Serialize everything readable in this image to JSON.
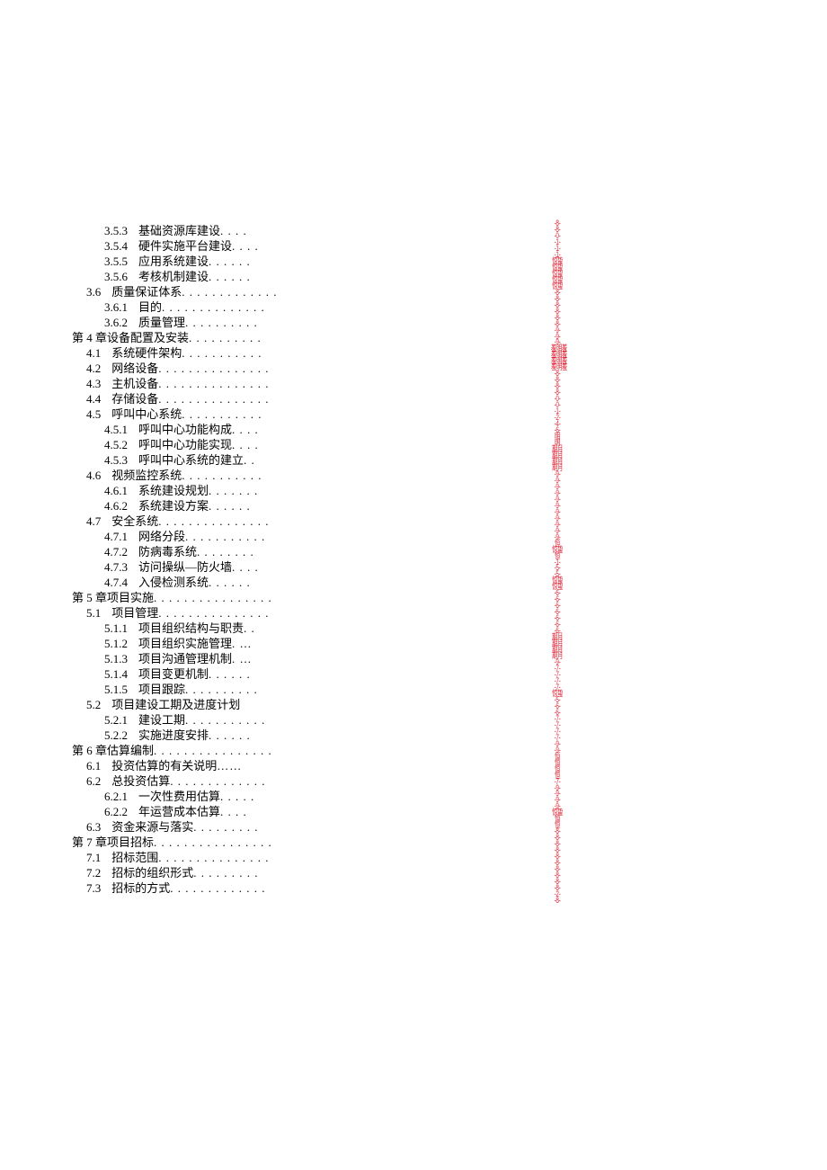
{
  "toc": [
    {
      "level": 2,
      "num": "3.5.3",
      "title": "基础资源库建设",
      "dots": " . . . ."
    },
    {
      "level": 2,
      "num": "3.5.4",
      "title": "硬件实施平台建设",
      "dots": ". . . ."
    },
    {
      "level": 2,
      "num": "3.5.5",
      "title": "应用系统建设",
      "dots": " . . . . . ."
    },
    {
      "level": 2,
      "num": "3.5.6",
      "title": "考核机制建设",
      "dots": " . . . . . ."
    },
    {
      "level": 1,
      "num": "3.6",
      "title": "质量保证体系",
      "dots": " . . . . . . . . . . . . ."
    },
    {
      "level": 2,
      "num": "3.6.1",
      "title": "目的",
      "dots": ". . . . . . . . . . . . . ."
    },
    {
      "level": 2,
      "num": "3.6.2",
      "title": "质量管理",
      "dots": " . . . . . . . . . ."
    },
    {
      "level": 0,
      "num": "第 4 章",
      "title": "设备配置及安装",
      "dots": " . . . . . . . . . .",
      "chapter": true
    },
    {
      "level": 1,
      "num": "4.1",
      "title": "系统硬件架构",
      "dots": " . . . . . . . . . . ."
    },
    {
      "level": 1,
      "num": "4.2",
      "title": "网络设备",
      "dots": " . . . . . . . . . . . . . . ."
    },
    {
      "level": 1,
      "num": "4.3",
      "title": "主机设备",
      "dots": " . . . . . . . . . . . . . . ."
    },
    {
      "level": 1,
      "num": "4.4",
      "title": "存储设备",
      "dots": " . . . . . . . . . . . . . . ."
    },
    {
      "level": 1,
      "num": "4.5",
      "title": "呼叫中心系统",
      "dots": ". . . . . . . . . . ."
    },
    {
      "level": 2,
      "num": "4.5.1",
      "title": "呼叫中心功能构成",
      "dots": ". . . ."
    },
    {
      "level": 2,
      "num": "4.5.2",
      "title": "呼叫中心功能实现",
      "dots": ". . . ."
    },
    {
      "level": 2,
      "num": "4.5.3",
      "title": "呼叫中心系统的建立",
      "dots": ". ."
    },
    {
      "level": 1,
      "num": "4.6",
      "title": "视频监控系统",
      "dots": " . . . . . . . . . . ."
    },
    {
      "level": 2,
      "num": "4.6.1",
      "title": "系统建设规划",
      "dots": ". . . . . . ."
    },
    {
      "level": 2,
      "num": "4.6.2",
      "title": "系统建设方案",
      "dots": " . . . . . ."
    },
    {
      "level": 1,
      "num": "4.7",
      "title": "安全系统",
      "dots": ". . . . . . . . . . . . . . ."
    },
    {
      "level": 2,
      "num": "4.7.1",
      "title": "网络分段",
      "dots": ". . . . . . . . . . ."
    },
    {
      "level": 2,
      "num": "4.7.2",
      "title": "防病毒系统",
      "dots": " . . . . . . . ."
    },
    {
      "level": 2,
      "num": "4.7.3",
      "title": "访问操纵—防火墙",
      "dots": ". . . ."
    },
    {
      "level": 2,
      "num": "4.7.4",
      "title": "入侵检测系统",
      "dots": " . . . . . ."
    },
    {
      "level": 0,
      "num": "第 5 章",
      "title": "项目实施",
      "dots": " . . . . . . . . . . . . . . . .",
      "chapter": true
    },
    {
      "level": 1,
      "num": "5.1",
      "title": "项目管理",
      "dots": " . . . . . . . . . . . . . . ."
    },
    {
      "level": 2,
      "num": "5.1.1",
      "title": "项目组织结构与职责",
      "dots": ". ."
    },
    {
      "level": 2,
      "num": "5.1.2",
      "title": "项目组织实施管理",
      "dots": ". …"
    },
    {
      "level": 2,
      "num": "5.1.3",
      "title": "项目沟通管理机制",
      "dots": ". …"
    },
    {
      "level": 2,
      "num": "5.1.4",
      "title": "项目变更机制",
      "dots": " . . . . . ."
    },
    {
      "level": 2,
      "num": "5.1.5",
      "title": "项目跟踪",
      "dots": " . . . . . . . . . ."
    },
    {
      "level": 1,
      "num": "5.2",
      "title": "项目建设工期及进度计划",
      "dots": ""
    },
    {
      "level": 2,
      "num": "5.2.1",
      "title": "建设工期",
      "dots": ". . . . . . . . . . ."
    },
    {
      "level": 2,
      "num": "5.2.2",
      "title": "实施进度安排",
      "dots": " . . . . . ."
    },
    {
      "level": 0,
      "num": "第 6 章",
      "title": "估算编制",
      "dots": " . . . . . . . . . . . . . . . .",
      "chapter": true
    },
    {
      "level": 1,
      "num": "6.1",
      "title": "投资估算的有关说明",
      "dots": "……"
    },
    {
      "level": 1,
      "num": "6.2",
      "title": "总投资估算",
      "dots": ". . . . . . . . . . . . ."
    },
    {
      "level": 2,
      "num": "6.2.1",
      "title": "一次性费用估算",
      "dots": ". . . . ."
    },
    {
      "level": 2,
      "num": "6.2.2",
      "title": "年运营成本估算",
      "dots": " . . . ."
    },
    {
      "level": 1,
      "num": "6.3",
      "title": "资金来源与落实",
      "dots": " . . . . . . . . ."
    },
    {
      "level": 0,
      "num": "第 7 章",
      "title": "项目招标",
      "dots": " . . . . . . . . . . . . . . . .",
      "chapter": true
    },
    {
      "level": 1,
      "num": "7.1",
      "title": "招标范围",
      "dots": " . . . . . . . . . . . . . . ."
    },
    {
      "level": 1,
      "num": "7.2",
      "title": "招标的组织形式",
      "dots": " . . . . . . . . ."
    },
    {
      "level": 1,
      "num": "7.3",
      "title": "招标的方式",
      "dots": " . . . . . . . . . . . . ."
    }
  ],
  "pages": [
    "-8-",
    "-8-",
    "-0-",
    "-1-",
    "-1-",
    "-1-",
    "惊蛰",
    "惊蛰",
    "惊蛰",
    "惊蛰",
    "惊蛰",
    "-8-",
    "-8-",
    "-8-",
    "-8-",
    "-8-",
    "-8-",
    "-9-",
    "-9-",
    "-9-",
    "羞明羞",
    "羞明羞",
    "羞明羞",
    "羞明羞",
    "-8-",
    "-8-",
    "-8-",
    "-8-",
    "-0-",
    "-0-",
    "-1-",
    "-2-",
    "-4-",
    "-6-",
    "明",
    "明",
    "期月",
    "期月",
    "期月",
    "期月",
    "-9-",
    "-9-",
    "-9-",
    "-9-",
    "-9-",
    "-9-",
    "-9-",
    "-9-",
    "-9-",
    "-9-",
    "-9-",
    "恒",
    "惊蛰",
    "恒",
    "-1-",
    "-5-",
    "-5-",
    "惊蛰",
    "惊蛰",
    "-6-",
    "-6-",
    "-6-",
    "-6-",
    "-6-",
    "-6-",
    "-6-",
    "期月",
    "期月",
    "期月",
    "期月",
    "-9-",
    "-7-",
    "-7-",
    "-7-",
    "-7-",
    "惊蛰",
    "-5-",
    "-6-",
    "-6-",
    "-7-",
    "-7-",
    "-7-",
    "-7-",
    "-9-",
    "-9-",
    "恒",
    "恒",
    "恒",
    "恒",
    "-7-",
    "-9-",
    "-9-",
    "-9-",
    "-9-",
    "惊蛰",
    "恒",
    "恒",
    "-8-",
    "-8-",
    "-8-",
    "-8-",
    "-8-",
    "-8-",
    "-8-",
    "-8-",
    "-8-",
    "-8-",
    "-2-",
    "-8-"
  ]
}
